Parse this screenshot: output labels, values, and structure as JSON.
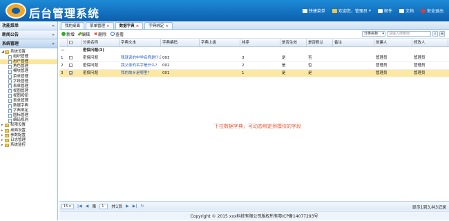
{
  "app": {
    "title": "后台管理系统"
  },
  "topnav": {
    "shortcut": "快捷菜单",
    "welcome": "欢迎您，管理员",
    "mail": "邮件",
    "docs": "文档",
    "logout": "安全退出"
  },
  "sidebar": {
    "panels": [
      {
        "label": "功能菜单",
        "chevron": "«"
      },
      {
        "label": "新闻公告",
        "chevron": "»"
      },
      {
        "label": "系统管理",
        "chevron": "»"
      }
    ],
    "tree": [
      {
        "label": "系统设置",
        "kind": "folder",
        "level": 0
      },
      {
        "label": "组织管理",
        "kind": "page",
        "level": 1
      },
      {
        "label": "用户管理",
        "kind": "page",
        "level": 1,
        "selected": true
      },
      {
        "label": "角色管理",
        "kind": "page",
        "level": 1
      },
      {
        "label": "模块管理",
        "kind": "page",
        "level": 1
      },
      {
        "label": "菜单管理",
        "kind": "page",
        "level": 1
      },
      {
        "label": "字段管理",
        "kind": "page",
        "level": 1
      },
      {
        "label": "表单管理",
        "kind": "page",
        "level": 1
      },
      {
        "label": "视图管理",
        "kind": "page",
        "level": 1
      },
      {
        "label": "视图按钮",
        "kind": "page",
        "level": 1
      },
      {
        "label": "表单管理",
        "kind": "page",
        "level": 1
      },
      {
        "label": "数据字典",
        "kind": "page",
        "level": 1
      },
      {
        "label": "字典绑定",
        "kind": "page",
        "level": 1
      },
      {
        "label": "图标管理",
        "kind": "page",
        "level": 1
      },
      {
        "label": "编码规则",
        "kind": "page",
        "level": 1
      },
      {
        "label": "权限设置",
        "kind": "folder",
        "level": 0
      },
      {
        "label": "桌面设置",
        "kind": "folder",
        "level": 0
      },
      {
        "label": "参数配置",
        "kind": "folder",
        "level": 0
      },
      {
        "label": "日志管理",
        "kind": "folder",
        "level": 0
      },
      {
        "label": "系统监控",
        "kind": "folder",
        "level": 0
      }
    ]
  },
  "tabs": [
    {
      "label": "我的桌面",
      "closable": false
    },
    {
      "label": "菜单管理",
      "closable": true
    },
    {
      "label": "数据字典",
      "closable": true,
      "active": true
    },
    {
      "label": "字典绑定",
      "closable": true
    }
  ],
  "toolbar": {
    "add": "新增",
    "edit": "编辑",
    "delete": "删除",
    "view": "查看"
  },
  "search": {
    "field": "分类名称",
    "placeholder": "请输入搜索值"
  },
  "grid": {
    "columns": [
      "",
      "分类名称",
      "字典文本",
      "字典编码",
      "字典上级",
      "排序",
      "是否生效",
      "是否默认",
      "备注",
      "创建人",
      "修改人"
    ],
    "group_label": "密保问题(3)",
    "rows": [
      {
        "num": "1",
        "category": "密保问题",
        "text": "我就读的中学名称是什么?",
        "code": "003",
        "parent": "",
        "sort": "3",
        "active": "是",
        "default": "否",
        "note": "",
        "creator": "管理员",
        "modifier": "管理员",
        "checked": false,
        "selected": false
      },
      {
        "num": "2",
        "category": "密保问题",
        "text": "我父亲的名字是什么?",
        "code": "002",
        "parent": "",
        "sort": "2",
        "active": "是",
        "default": "否",
        "note": "",
        "creator": "管理员",
        "modifier": "管理员",
        "checked": false,
        "selected": false
      },
      {
        "num": "3",
        "category": "密保问题",
        "text": "我的故乡是哪里?",
        "code": "001",
        "parent": "",
        "sort": "1",
        "active": "是",
        "default": "是",
        "note": "",
        "creator": "管理员",
        "modifier": "管理员",
        "checked": true,
        "selected": true
      }
    ],
    "annotation": "下拉数据字典，可动态绑定到模块的字段"
  },
  "pager": {
    "page_size": "15",
    "page_prefix": "第",
    "page": "1",
    "page_suffix": "共1页",
    "info": "显示1到3,共3记录"
  },
  "footer": {
    "text": "Copyright © 2015 xxx科技有限公司版权所有粤ICP备14077293号"
  }
}
